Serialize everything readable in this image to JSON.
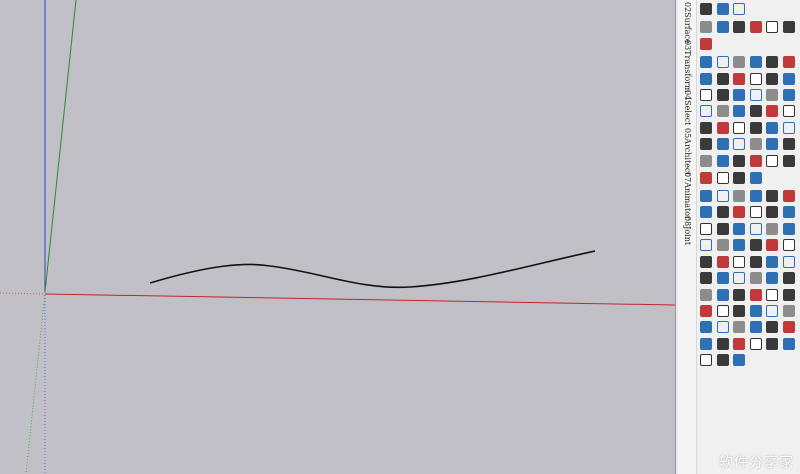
{
  "panel_tabs": [
    "02Surface",
    "03Transform",
    "04Select",
    "05Architect",
    "07Animator",
    "08Joint"
  ],
  "watermark": "软件分享家",
  "colors": {
    "viewport_bg": "#c1c0c6",
    "axis_red": "#c0262c",
    "axis_green": "#2e8a2e",
    "axis_blue": "#3b3bd0",
    "curve": "#111111"
  },
  "toolbar_icons": [
    "cube-group-icon",
    "cube-component-icon",
    "help-icon",
    "box-icon",
    "house-icon",
    "house-outline-icon",
    "building-icon",
    "roof-icon",
    "roof-alt-icon",
    "building-3d-icon",
    "bracket-icon",
    "bracket-alt-icon",
    "angle-icon",
    "bracket-open-icon",
    "bracket-close-icon",
    "angle-alt-icon",
    "sphere-icon",
    "torus-icon",
    "eye-icon",
    "move-icon",
    "move-cross-icon",
    "puzzle-icon",
    "spiral-icon",
    "spring-icon",
    "curve-arrow-icon",
    "scale-icon",
    "triangle-icon",
    "bevel-icon",
    "corner-icon",
    "corner-alt-icon",
    "arc-icon",
    "fillet-icon",
    "arc-alt-icon",
    "wave-icon",
    "stair-icon",
    "stair-alt-icon",
    "fence-icon",
    "grid-icon",
    "ladder-icon",
    "railing-icon",
    "ring-icon",
    "path-icon",
    "frame-icon",
    "dot-icon",
    "line-icon",
    "wave-alt-icon",
    "figure-icon",
    "zigzag-icon",
    "gear-icon",
    "lasso-icon",
    "link-icon",
    "chain-icon",
    "pin-icon",
    "stack-icon",
    "axis-icon",
    "chart-icon",
    "pencil-icon",
    "search-icon",
    "line-tool-icon",
    "undo-icon",
    "redo-icon",
    "pointer-icon",
    "eraser-icon",
    "paint-icon",
    "knife-icon",
    "curves-icon",
    "square-icon",
    "grid-alt-icon",
    "circle-icon",
    "polygon-icon",
    "arc-tool-icon",
    "pie-icon",
    "cone-icon",
    "shell-icon",
    "move-tool-icon",
    "rotate-icon",
    "refresh-icon",
    "offset-icon",
    "push-pull-icon",
    "follow-me-icon",
    "tape-icon",
    "protractor-icon",
    "dimension-icon",
    "text-icon",
    "axes-icon",
    "section-icon",
    "orbit-icon",
    "pan-icon",
    "zoom-icon",
    "zoom-window-icon",
    "zoom-extents-icon",
    "previous-view-icon",
    "walk-icon",
    "look-around-icon",
    "position-camera-icon",
    "footprints-icon",
    "iso-view-icon",
    "top-view-icon",
    "front-view-icon",
    "right-view-icon",
    "back-view-icon",
    "left-view-icon",
    "bottom-view-icon",
    "xray-icon",
    "wireframe-icon",
    "hidden-line-icon",
    "shaded-icon",
    "textured-icon",
    "monochrome-icon",
    "back-edges-icon",
    "rectangle-icon",
    "rotated-rect-icon",
    "camera-icon",
    "measure-icon",
    "close-icon",
    "expand-icon",
    "settings-icon",
    "add-layer-icon",
    "reload-icon"
  ]
}
